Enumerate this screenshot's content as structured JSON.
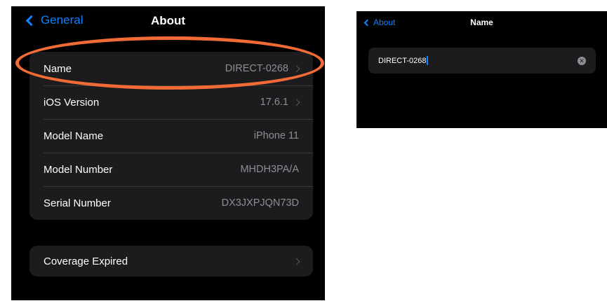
{
  "about_screen": {
    "back_label": "General",
    "title": "About",
    "info_rows": [
      {
        "label": "Name",
        "value": "DIRECT-0268",
        "chevron": true
      },
      {
        "label": "iOS Version",
        "value": "17.6.1",
        "chevron": true
      },
      {
        "label": "Model Name",
        "value": "iPhone 11",
        "chevron": false
      },
      {
        "label": "Model Number",
        "value": "MHDH3PA/A",
        "chevron": false
      },
      {
        "label": "Serial Number",
        "value": "DX3JXPJQN73D",
        "chevron": false
      }
    ],
    "coverage_label": "Coverage Expired"
  },
  "name_screen": {
    "back_label": "About",
    "title": "Name",
    "field_value": "DIRECT-0268"
  },
  "colors": {
    "background": "#000000",
    "group_bg": "#1c1c1e",
    "accent_blue": "#0a84ff",
    "annotation_orange": "#f26a35",
    "secondary_text": "#8e8e93"
  },
  "icons": {
    "back": "chevron-left-icon",
    "disclosure": "chevron-right-icon",
    "clear": "clear-circle-icon"
  }
}
